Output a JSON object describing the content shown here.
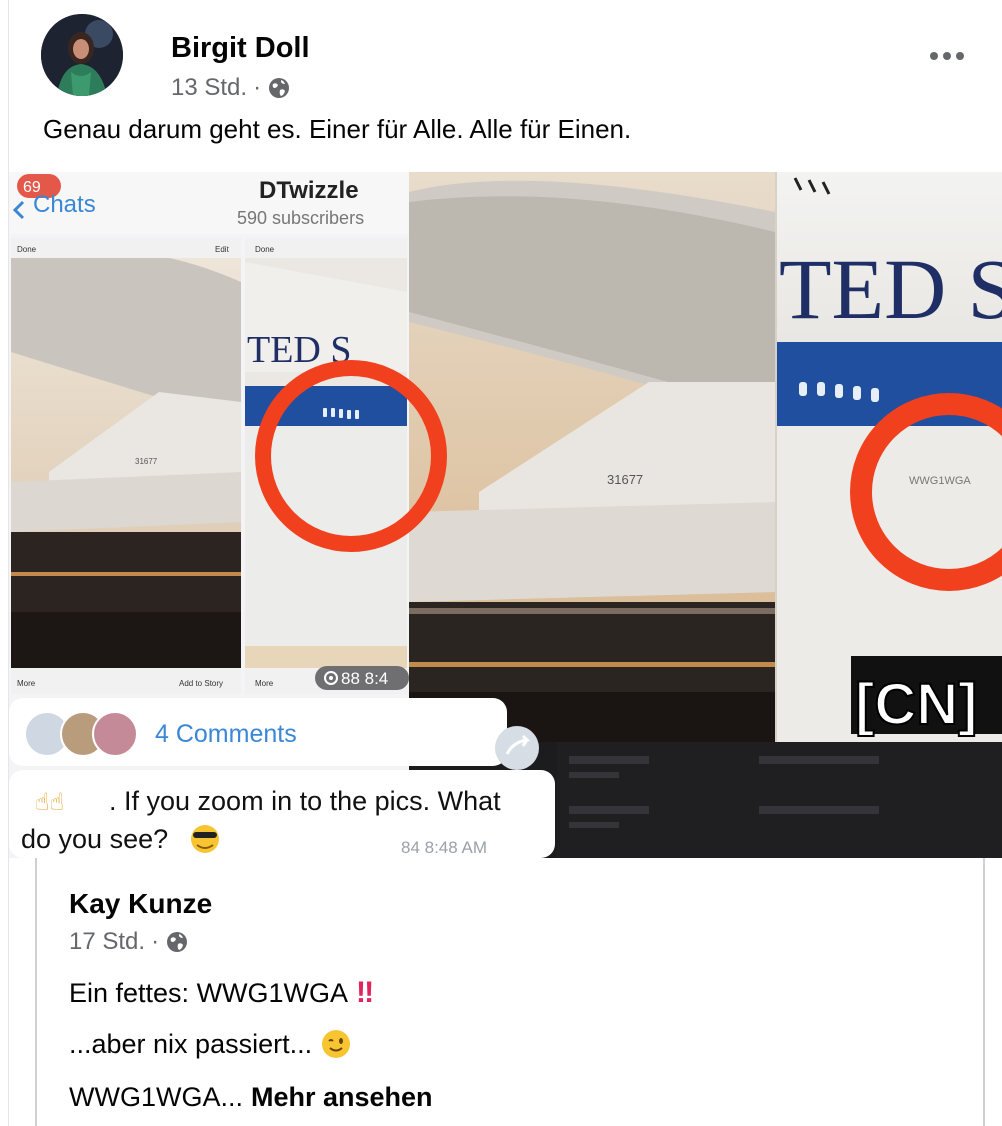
{
  "post": {
    "author": "Birgit Doll",
    "time": "13 Std.",
    "separator": "·",
    "text": "Genau darum geht es. Einer für Alle. Alle für Einen."
  },
  "image": {
    "telegram": {
      "back_label": "Chats",
      "unread_badge": "69",
      "channel_name": "DTwizzle",
      "subscribers": "590 subscribers",
      "left_done": "Done",
      "left_edit": "Edit",
      "right_done": "Done",
      "left_more": "More",
      "add_to_story": "Add to Story",
      "right_more": "More",
      "views": "88 8:4",
      "comments": "4 Comments",
      "message": ". If you zoom in to the pics. What do you see?",
      "message_meta": "84 8:48 AM"
    },
    "tail_number_small": "31677",
    "tail_number_large": "31677",
    "fuselage_text": "TED S",
    "fuselage_text_large": "TED S",
    "circled_code": "WWG1WGA",
    "watermark": "[CN]"
  },
  "shared": {
    "author": "Kay Kunze",
    "time": "17 Std.",
    "separator": "·",
    "line1": "Ein fettes: WWG1WGA",
    "line1_emoji": "‼",
    "line2": "...aber nix passiert...",
    "line3": "WWG1WGA...",
    "see_more": "Mehr ansehen"
  },
  "colors": {
    "meta_gray": "#65676b",
    "circle_red": "#f0401e",
    "fuselage_blue": "#1f4f9e"
  }
}
